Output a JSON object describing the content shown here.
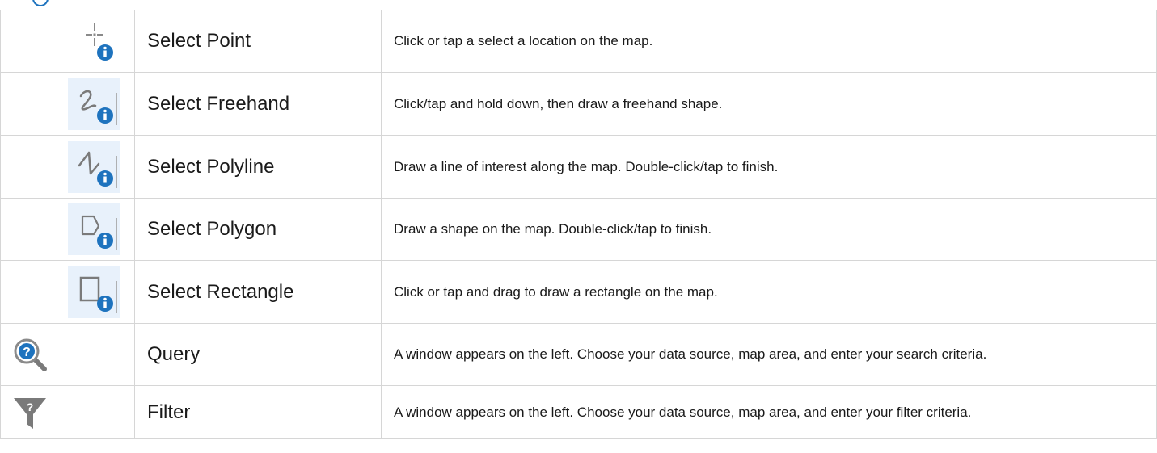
{
  "colors": {
    "border": "#d6d6d6",
    "info_blue": "#1e73be",
    "icon_gray": "#8a8a8a",
    "icon_bg": "#e8f1fb"
  },
  "rows": [
    {
      "icon": "select-point-icon",
      "name": "Select Point",
      "description": "Click or tap a select a location on the map."
    },
    {
      "icon": "select-freehand-icon",
      "name": "Select Freehand",
      "description": "Click/tap and hold down, then draw a freehand shape."
    },
    {
      "icon": "select-polyline-icon",
      "name": "Select Polyline",
      "description": "Draw a line of interest along the map. Double-click/tap to finish."
    },
    {
      "icon": "select-polygon-icon",
      "name": "Select Polygon",
      "description": "Draw a shape on the map. Double-click/tap to finish."
    },
    {
      "icon": "select-rectangle-icon",
      "name": "Select Rectangle",
      "description": "Click or tap and drag to draw a rectangle on the map."
    },
    {
      "icon": "query-icon",
      "name": "Query",
      "description": "A window appears on the left.  Choose your data source, map area, and enter your search criteria."
    },
    {
      "icon": "filter-icon",
      "name": "Filter",
      "description": "A window appears on the left.  Choose your data source, map area, and enter your filter criteria."
    }
  ]
}
